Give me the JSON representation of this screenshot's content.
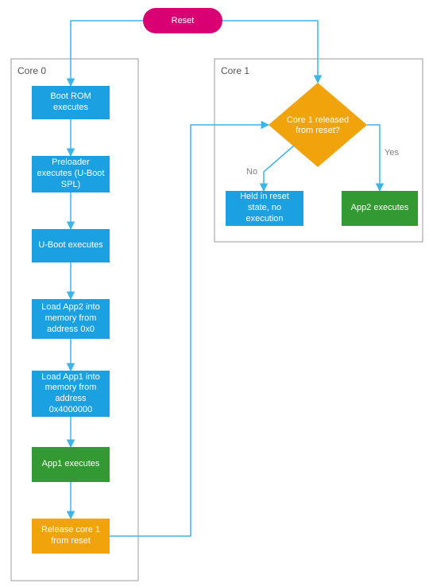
{
  "reset": {
    "label": "Reset"
  },
  "core0": {
    "title": "Core 0",
    "steps": {
      "bootrom": "Boot ROM executes",
      "preloader": "Preloader executes (U-Boot SPL)",
      "uboot": "U-Boot executes",
      "loadapp2": "Load App2 into memory from address 0x0",
      "loadapp1": "Load App1 into memory from address 0x4000000",
      "app1": "App1 executes",
      "release": "Release core 1 from reset"
    }
  },
  "core1": {
    "title": "Core 1",
    "decision": "Core 1 released from reset?",
    "yes_label": "Yes",
    "no_label": "No",
    "held": "Held in reset state, no execution",
    "app2": "App2 executes"
  },
  "colors": {
    "blue": "#1ba1e2",
    "green": "#339933",
    "orange": "#f0a30a",
    "pink": "#d80073",
    "arrow": "#3fb4e6",
    "border": "#999999"
  }
}
